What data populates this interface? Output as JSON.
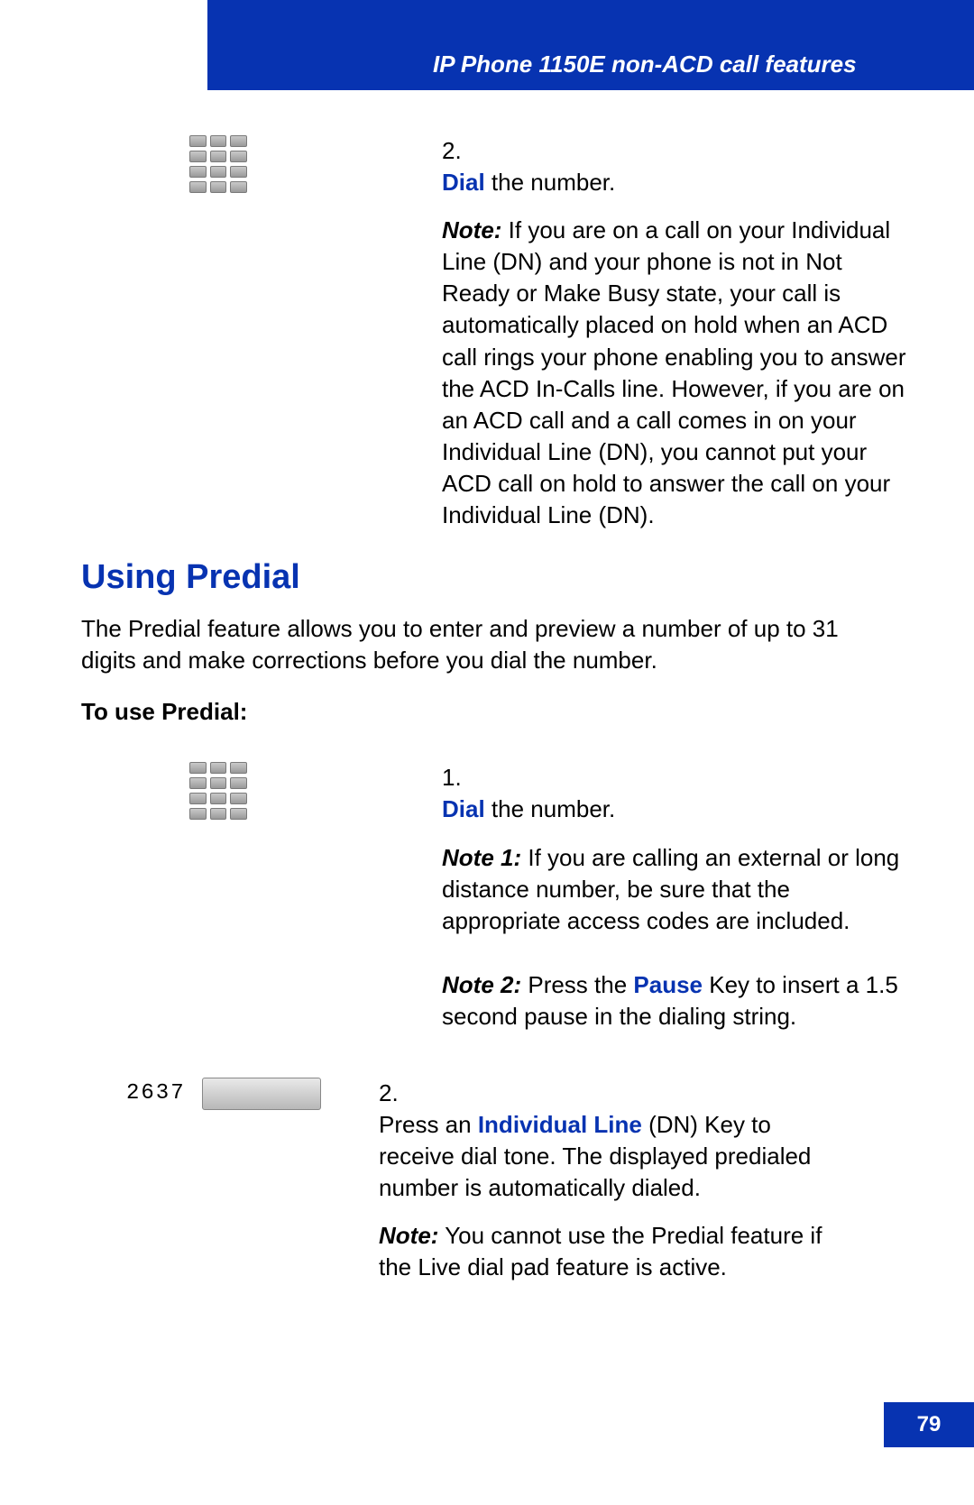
{
  "header": {
    "title": "IP Phone 1150E non-ACD call features"
  },
  "top_step": {
    "num": "2.",
    "action_kw": "Dial",
    "action_rest": " the number.",
    "note_label": "Note:",
    "note_body": " If you are on a call on your Individual Line (DN) and your phone is not in Not Ready or Make Busy state, your call is automatically placed on hold when an ACD call rings your phone enabling you to answer the ACD In-Calls line. However, if you are on an ACD call and a call comes in on your Individual Line (DN), you cannot put your ACD call on hold to answer the call on your Individual Line (DN)."
  },
  "section": {
    "heading": "Using Predial",
    "intro": "The Predial feature allows you to enter and preview a number of up to 31 digits and make corrections before you dial the number.",
    "subhead": "To use Predial:"
  },
  "predial_steps": {
    "s1": {
      "num": "1.",
      "action_kw": "Dial",
      "action_rest": " the number.",
      "note1_label": "Note 1:",
      "note1_body": " If you are calling an external or long distance number, be sure that the appropriate access codes are included.",
      "note2_label": "Note 2:",
      "note2_pre": " Press the ",
      "note2_kw": "Pause",
      "note2_post": " Key to insert a 1.5 second pause in the dialing string."
    },
    "s2": {
      "display": "2637",
      "num": "2.",
      "pre": "Press an ",
      "kw": "Individual Line",
      "post": " (DN) Key to receive dial tone. The displayed predialed number is automatically dialed.",
      "note_label": "Note:",
      "note_body": " You cannot use the Predial feature if the Live dial pad feature is active."
    }
  },
  "page_number": "79"
}
